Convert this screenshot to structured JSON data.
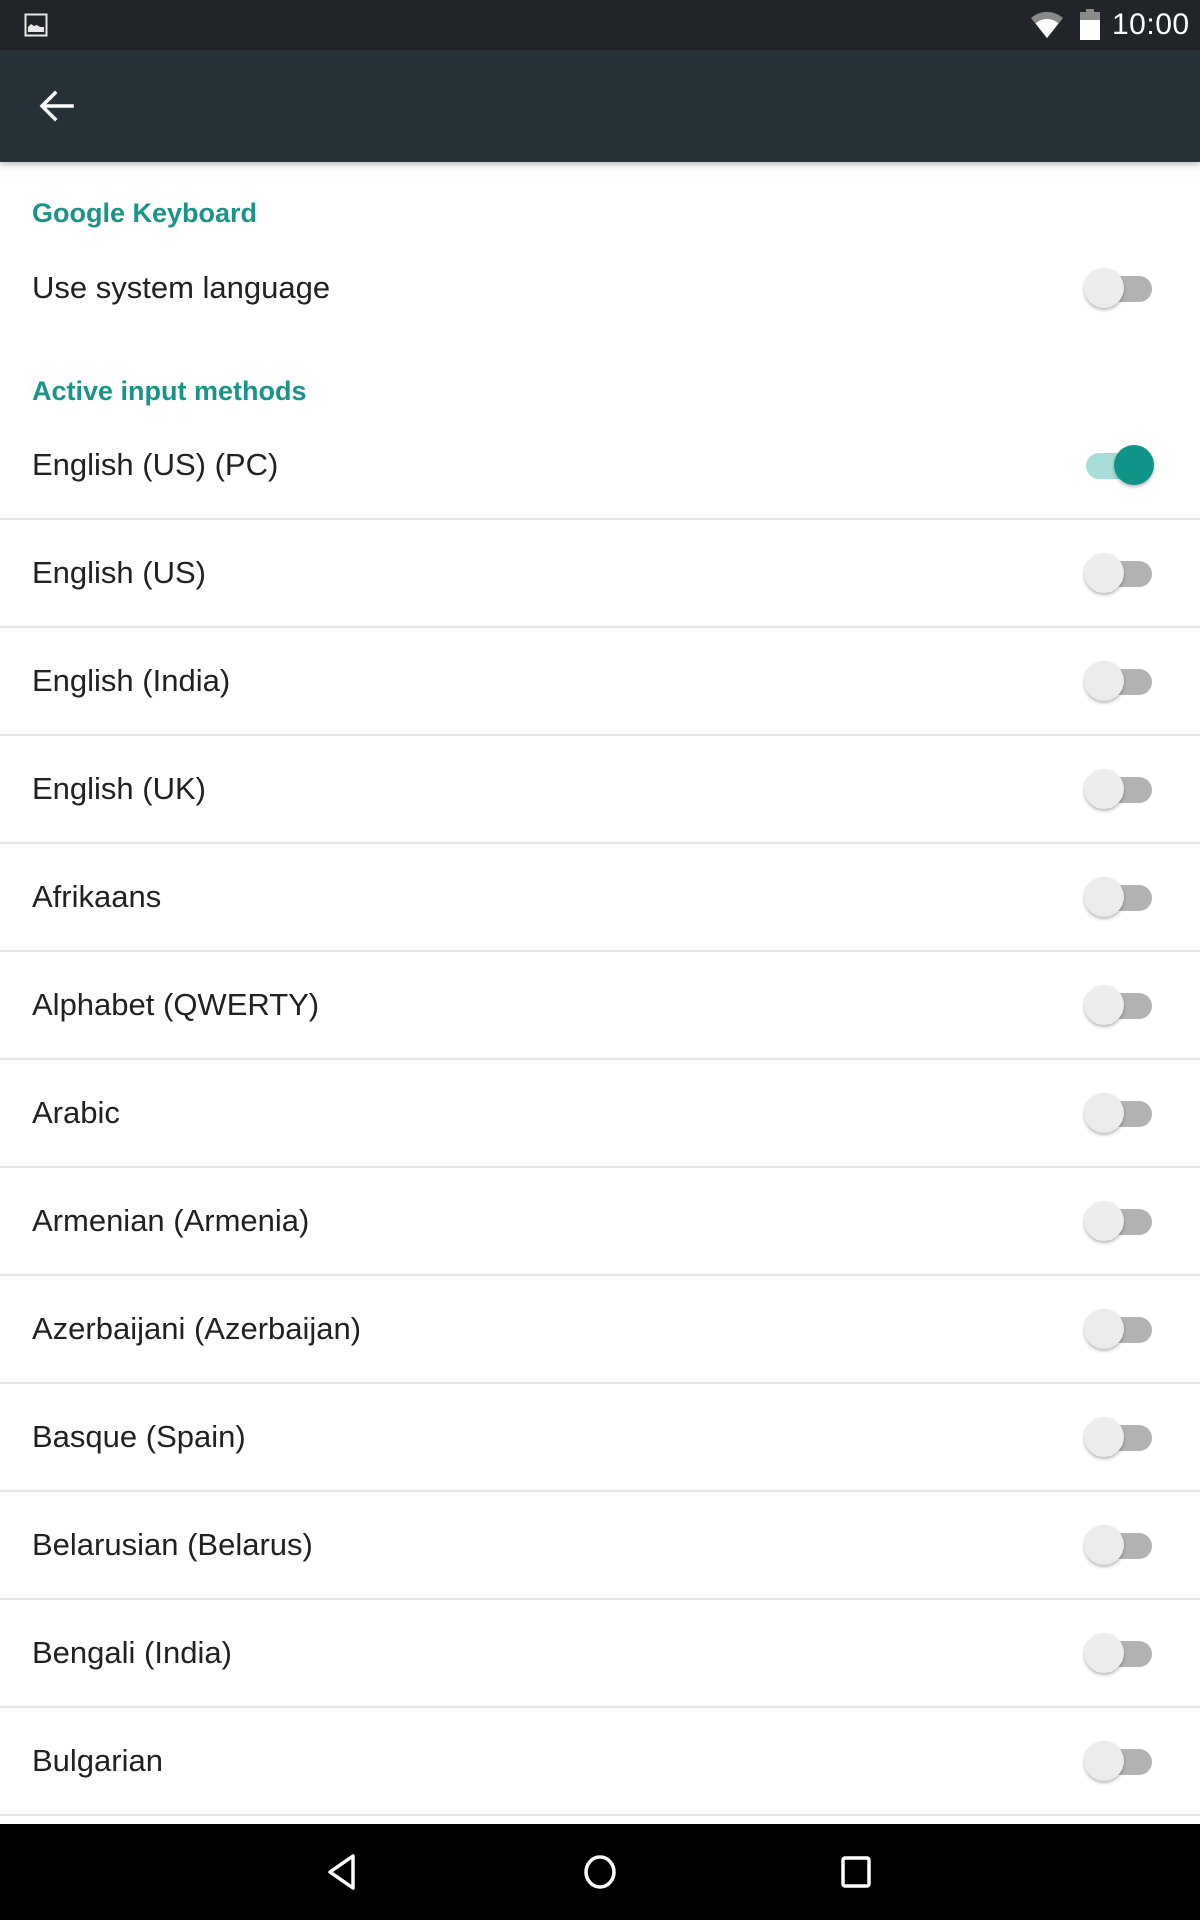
{
  "status_bar": {
    "notification_icon": "image-icon",
    "wifi_icon": "wifi-icon",
    "battery_icon": "battery-icon",
    "time": "10:00"
  },
  "app_bar": {
    "back_icon": "arrow-back-icon"
  },
  "colors": {
    "status_bar_bg": "#212529",
    "app_bar_bg": "#263238",
    "accent": "#109488",
    "category_text": "#1a9488",
    "switch_track_on": "#a6ddd8",
    "switch_track_off": "#b2b2b2",
    "switch_thumb_off": "#ececec"
  },
  "sections": [
    {
      "title": "Google Keyboard",
      "items": [
        {
          "label": "Use system language",
          "checked": false
        }
      ]
    },
    {
      "title": "Active input methods",
      "items": [
        {
          "label": "English (US) (PC)",
          "checked": true
        },
        {
          "label": "English (US)",
          "checked": false
        },
        {
          "label": "English (India)",
          "checked": false
        },
        {
          "label": "English (UK)",
          "checked": false
        },
        {
          "label": "Afrikaans",
          "checked": false
        },
        {
          "label": "Alphabet (QWERTY)",
          "checked": false
        },
        {
          "label": "Arabic",
          "checked": false
        },
        {
          "label": "Armenian (Armenia)",
          "checked": false
        },
        {
          "label": "Azerbaijani (Azerbaijan)",
          "checked": false
        },
        {
          "label": "Basque (Spain)",
          "checked": false
        },
        {
          "label": "Belarusian (Belarus)",
          "checked": false
        },
        {
          "label": "Bengali (India)",
          "checked": false
        },
        {
          "label": "Bulgarian",
          "checked": false
        }
      ]
    }
  ],
  "nav_bar": {
    "back": "nav-back-icon",
    "home": "nav-home-icon",
    "recents": "nav-recents-icon"
  }
}
